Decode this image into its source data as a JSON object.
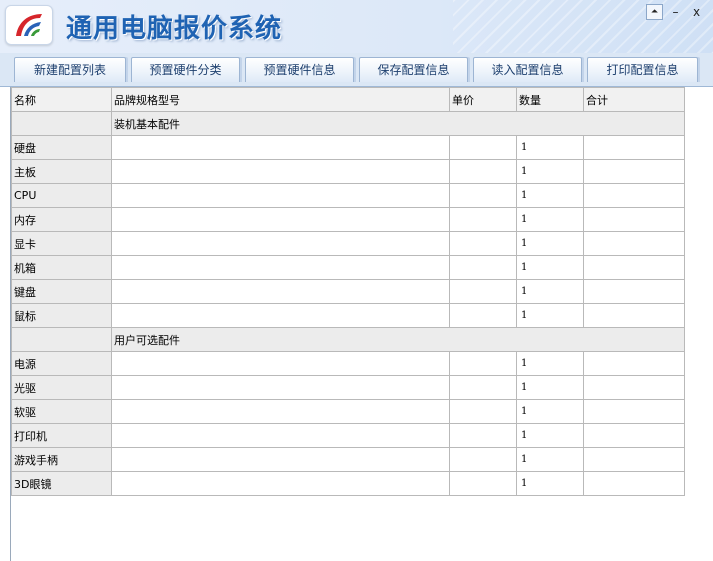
{
  "window": {
    "title": "通用电脑报价系统",
    "controls": {
      "restore": "⏶",
      "minimize": "–",
      "close": "x"
    }
  },
  "icons": {
    "logo": "app-logo-icon"
  },
  "colors": {
    "title": "#1f63b3",
    "header_bg": "#dce8f8",
    "tab_text": "#1d3f6e"
  },
  "tabs": [
    {
      "label": "新建配置列表"
    },
    {
      "label": "预置硬件分类"
    },
    {
      "label": "预置硬件信息"
    },
    {
      "label": "保存配置信息"
    },
    {
      "label": "读入配置信息"
    },
    {
      "label": "打印配置信息"
    }
  ],
  "table": {
    "columns": [
      "名称",
      "品牌规格型号",
      "单价",
      "数量",
      "合计"
    ],
    "sections": [
      {
        "title": "装机基本配件",
        "rows": [
          {
            "name": "硬盘",
            "model": "",
            "price": "",
            "qty": "1",
            "total": ""
          },
          {
            "name": "主板",
            "model": "",
            "price": "",
            "qty": "1",
            "total": ""
          },
          {
            "name": "CPU",
            "model": "",
            "price": "",
            "qty": "1",
            "total": ""
          },
          {
            "name": "内存",
            "model": "",
            "price": "",
            "qty": "1",
            "total": ""
          },
          {
            "name": "显卡",
            "model": "",
            "price": "",
            "qty": "1",
            "total": ""
          },
          {
            "name": "机箱",
            "model": "",
            "price": "",
            "qty": "1",
            "total": ""
          },
          {
            "name": "键盘",
            "model": "",
            "price": "",
            "qty": "1",
            "total": ""
          },
          {
            "name": "鼠标",
            "model": "",
            "price": "",
            "qty": "1",
            "total": ""
          }
        ]
      },
      {
        "title": "用户可选配件",
        "rows": [
          {
            "name": "电源",
            "model": "",
            "price": "",
            "qty": "1",
            "total": ""
          },
          {
            "name": "光驱",
            "model": "",
            "price": "",
            "qty": "1",
            "total": ""
          },
          {
            "name": "软驱",
            "model": "",
            "price": "",
            "qty": "1",
            "total": ""
          },
          {
            "name": "打印机",
            "model": "",
            "price": "",
            "qty": "1",
            "total": ""
          },
          {
            "name": "游戏手柄",
            "model": "",
            "price": "",
            "qty": "1",
            "total": ""
          },
          {
            "name": "3D眼镜",
            "model": "",
            "price": "",
            "qty": "1",
            "total": ""
          }
        ]
      }
    ]
  }
}
